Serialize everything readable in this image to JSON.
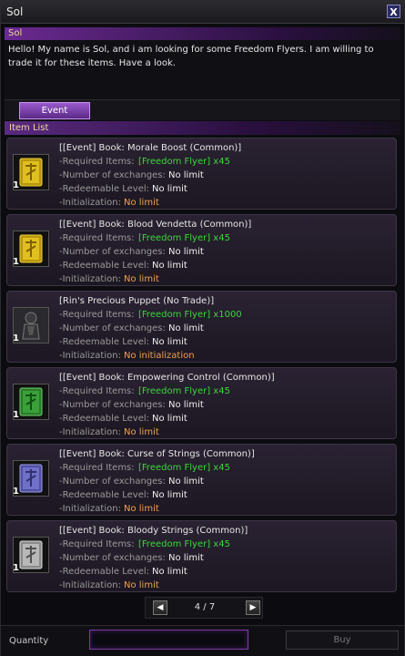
{
  "window": {
    "title": "Sol",
    "close_label": "X"
  },
  "npc": {
    "name": "Sol",
    "dialog": "Hello! My name is Sol, and i am looking for some Freedom Flyers. I am willing to trade it for these items. Have a look."
  },
  "tabs": [
    {
      "label": "Event",
      "active": true
    }
  ],
  "item_list": {
    "header": "Item List",
    "labels": {
      "required": "-Required Items:",
      "exchanges": "-Number of exchanges:",
      "level": "-Redeemable Level:",
      "init": "-Initialization:"
    },
    "items": [
      {
        "name": "[[Event] Book: Morale Boost (Common)]",
        "icon": "yellow-book-icon",
        "qty": "1",
        "required": "[Freedom Flyer] x45",
        "exchanges": "No limit",
        "level": "No limit",
        "init": "No limit"
      },
      {
        "name": "[[Event] Book: Blood Vendetta (Common)]",
        "icon": "yellow-book-icon",
        "qty": "1",
        "required": "[Freedom Flyer] x45",
        "exchanges": "No limit",
        "level": "No limit",
        "init": "No limit"
      },
      {
        "name": "[Rin's Precious Puppet (No Trade)]",
        "icon": "puppet-icon",
        "qty": "1",
        "required": "[Freedom Flyer] x1000",
        "exchanges": "No limit",
        "level": "No limit",
        "init": "No initialization"
      },
      {
        "name": "[[Event] Book: Empowering Control (Common)]",
        "icon": "green-book-icon",
        "qty": "1",
        "required": "[Freedom Flyer] x45",
        "exchanges": "No limit",
        "level": "No limit",
        "init": "No limit"
      },
      {
        "name": "[[Event] Book: Curse of Strings (Common)]",
        "icon": "purple-book-icon",
        "qty": "1",
        "required": "[Freedom Flyer] x45",
        "exchanges": "No limit",
        "level": "No limit",
        "init": "No limit"
      },
      {
        "name": "[[Event] Book: Bloody Strings (Common)]",
        "icon": "silver-book-icon",
        "qty": "1",
        "required": "[Freedom Flyer] x45",
        "exchanges": "No limit",
        "level": "No limit",
        "init": "No limit"
      }
    ]
  },
  "pager": {
    "text": "4 / 7",
    "prev": "◀",
    "next": "▶"
  },
  "footer": {
    "quantity_label": "Quantity",
    "quantity_value": "",
    "buy_label": "Buy"
  },
  "colors": {
    "accent": "#7a3aa0",
    "required_value": "#3ad83a",
    "init_value": "#f0a050"
  }
}
